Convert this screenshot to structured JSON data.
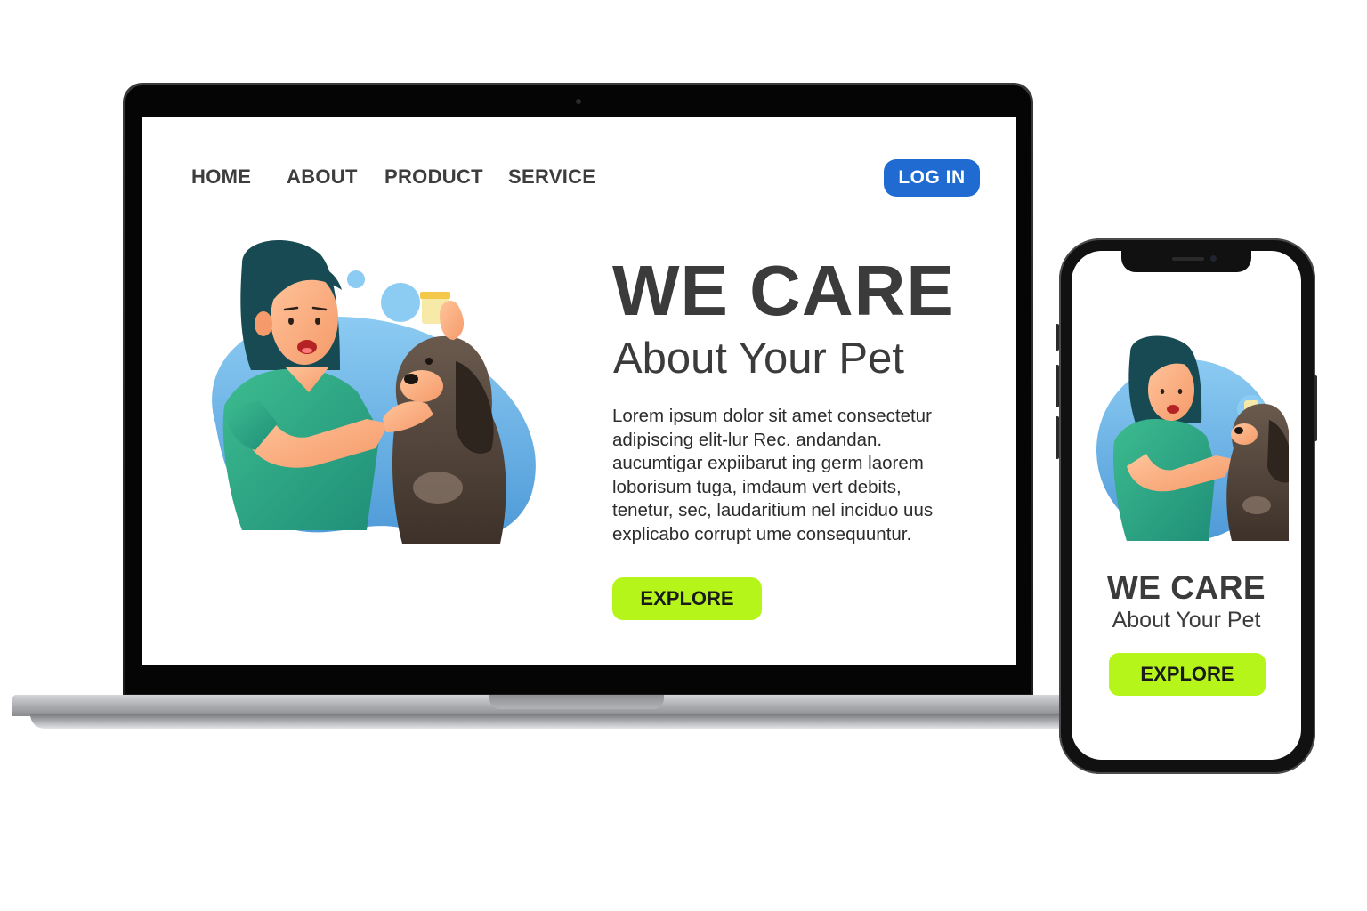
{
  "laptop": {
    "nav": {
      "items": [
        "HOME",
        "ABOUT",
        "PRODUCT",
        "SERVICE"
      ],
      "login_label": "LOG IN"
    },
    "hero": {
      "title": "WE CARE",
      "subtitle": "About Your Pet",
      "body_lines": [
        "Lorem ipsum dolor sit amet consectetur",
        "adipiscing  elit-lur Rec. andandan.",
        "aucumtigar  expiibarut ing germ laorem",
        "loborisum tuga, imdaum vert debits,",
        "tenetur, sec, laudaritium nel inciduo uus",
        "explicabo corrupt  ume consequuntur."
      ],
      "cta_label": "EXPLORE"
    }
  },
  "phone": {
    "title": "WE CARE",
    "subtitle": "About Your Pet",
    "cta_label": "EXPLORE"
  },
  "icons": {
    "hero_illustration": "vet-with-dog-illustration",
    "phone_illustration": "vet-with-dog-illustration"
  },
  "colors": {
    "login_button": "#1f6bd1",
    "explore_button": "#b6f51a",
    "heading_text": "#3b3b3b",
    "scrub_green": "#2ea783",
    "blob_blue": "#6fb3e6"
  }
}
